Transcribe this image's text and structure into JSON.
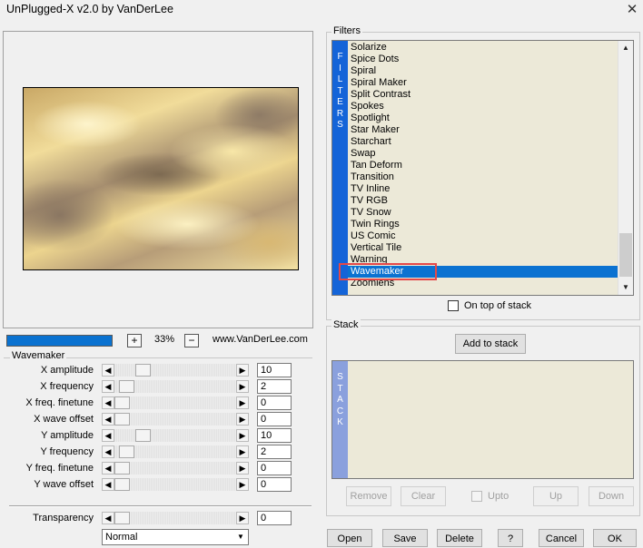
{
  "window": {
    "title": "UnPlugged-X v2.0 by VanDerLee",
    "close_icon": "close-icon"
  },
  "preview": {
    "progress_percent": 100,
    "zoom_in_label": "+",
    "zoom_value": "33%",
    "zoom_out_label": "−",
    "website": "www.VanDerLee.com"
  },
  "wavemaker": {
    "group_title": "Wavemaker",
    "params": [
      {
        "label": "X amplitude",
        "value": "10",
        "position": 0.2
      },
      {
        "label": "X frequency",
        "value": "2",
        "position": 0.04
      },
      {
        "label": "X freq. finetune",
        "value": "0",
        "position": 0.0
      },
      {
        "label": "X wave offset",
        "value": "0",
        "position": 0.0
      },
      {
        "label": "Y amplitude",
        "value": "10",
        "position": 0.2
      },
      {
        "label": "Y frequency",
        "value": "2",
        "position": 0.04
      },
      {
        "label": "Y freq. finetune",
        "value": "0",
        "position": 0.0
      },
      {
        "label": "Y wave offset",
        "value": "0",
        "position": 0.0
      }
    ]
  },
  "transparency": {
    "label": "Transparency",
    "value": "0",
    "position": 0.0
  },
  "blend_mode": {
    "selected": "Normal"
  },
  "filters": {
    "group_title": "Filters",
    "side_label": "FILTERS",
    "items": [
      "Solarize",
      "Spice Dots",
      "Spiral",
      "Spiral Maker",
      "Split Contrast",
      "Spokes",
      "Spotlight",
      "Star Maker",
      "Starchart",
      "Swap",
      "Tan Deform",
      "Transition",
      "TV Inline",
      "TV RGB",
      "TV Snow",
      "Twin Rings",
      "US Comic",
      "Vertical Tile",
      "Warning",
      "Wavemaker",
      "Zoomlens"
    ],
    "selected": "Wavemaker",
    "on_top_label": "On top of stack"
  },
  "stack": {
    "group_title": "Stack",
    "side_label": "STACK",
    "add_label": "Add to stack",
    "remove_label": "Remove",
    "clear_label": "Clear",
    "upto_label": "Upto",
    "up_label": "Up",
    "down_label": "Down"
  },
  "footer": {
    "open_label": "Open",
    "save_label": "Save",
    "delete_label": "Delete",
    "help_label": "?",
    "cancel_label": "Cancel",
    "ok_label": "OK"
  },
  "colors": {
    "accent": "#0b72d1",
    "filters_bar": "#1464d8",
    "stack_bar": "#8aa0dd",
    "highlight_box": "#e54848"
  }
}
